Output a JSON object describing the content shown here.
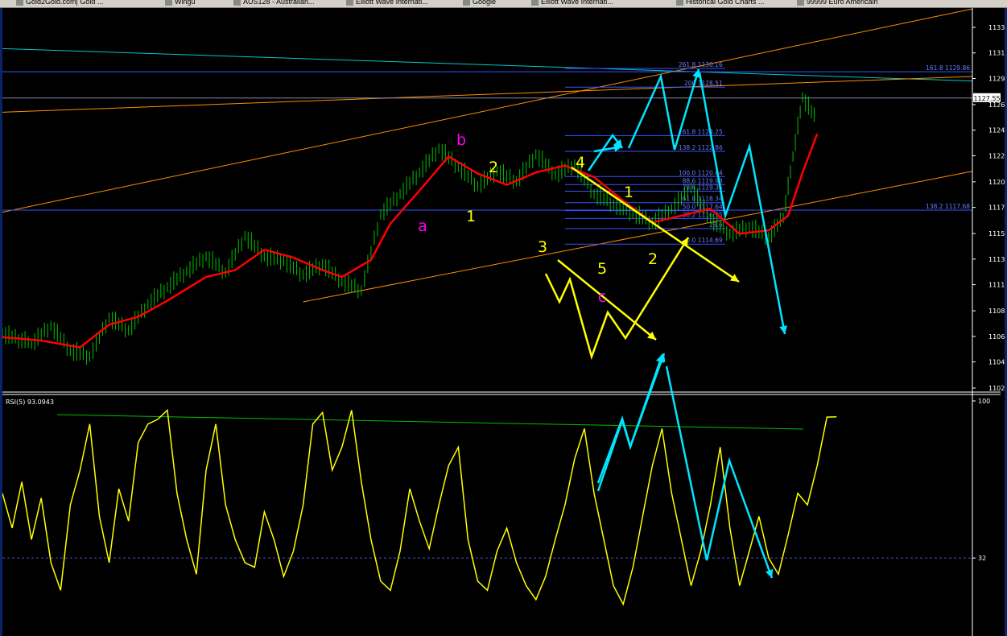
{
  "browser_tabs": [
    {
      "label": "Gold2Gold.com| Gold ...",
      "icon": "page-icon"
    },
    {
      "label": "Wingu",
      "icon": "page-icon"
    },
    {
      "label": "AUS128 - Australian...",
      "icon": "page-icon"
    },
    {
      "label": "Elliott Wave Internati...",
      "icon": "page-icon"
    },
    {
      "label": "Google",
      "icon": "google-icon"
    },
    {
      "label": "Elliott Wave Internati...",
      "icon": "page-icon"
    },
    {
      "label": "Historical Gold Charts ...",
      "icon": "page-icon"
    },
    {
      "label": "99999 Euro Americain",
      "icon": "page-icon"
    }
  ],
  "chart_data": [
    {
      "type": "line",
      "panel": "price",
      "y_ticks": [
        "1133.77",
        "1131.52",
        "1129.27",
        "1126.97",
        "1124.72",
        "1122.47",
        "1120.17",
        "1117.92",
        "1115.62",
        "1113.37",
        "1111.12",
        "1108.82",
        "1106.57",
        "1104.32",
        "1102.02"
      ],
      "ylim": [
        1102.02,
        1133.77
      ],
      "current_price_label": "1127.55",
      "series_colors": {
        "bars": "#00c000",
        "moving_average": "#ff0000"
      },
      "ma_path": [
        [
          0.0,
          1106.5
        ],
        [
          0.04,
          1106.2
        ],
        [
          0.08,
          1105.6
        ],
        [
          0.11,
          1107.6
        ],
        [
          0.14,
          1108.3
        ],
        [
          0.17,
          1109.7
        ],
        [
          0.21,
          1111.8
        ],
        [
          0.24,
          1112.4
        ],
        [
          0.27,
          1114.2
        ],
        [
          0.3,
          1113.5
        ],
        [
          0.33,
          1112.4
        ],
        [
          0.35,
          1111.8
        ],
        [
          0.38,
          1113.3
        ],
        [
          0.4,
          1116.5
        ],
        [
          0.43,
          1119.4
        ],
        [
          0.46,
          1122.4
        ],
        [
          0.49,
          1120.9
        ],
        [
          0.52,
          1119.9
        ],
        [
          0.55,
          1121.0
        ],
        [
          0.58,
          1121.6
        ],
        [
          0.61,
          1120.6
        ],
        [
          0.64,
          1118.5
        ],
        [
          0.67,
          1116.6
        ],
        [
          0.7,
          1117.2
        ],
        [
          0.73,
          1117.8
        ],
        [
          0.76,
          1115.6
        ],
        [
          0.79,
          1115.9
        ],
        [
          0.81,
          1117.2
        ],
        [
          0.825,
          1121.0
        ],
        [
          0.84,
          1124.4
        ]
      ],
      "price_path": [
        [
          0.0,
          1106.8
        ],
        [
          0.03,
          1105.9
        ],
        [
          0.05,
          1107.5
        ],
        [
          0.07,
          1105.3
        ],
        [
          0.09,
          1104.8
        ],
        [
          0.11,
          1108.2
        ],
        [
          0.13,
          1107.1
        ],
        [
          0.15,
          1109.4
        ],
        [
          0.17,
          1110.9
        ],
        [
          0.19,
          1112.3
        ],
        [
          0.21,
          1113.6
        ],
        [
          0.23,
          1112.2
        ],
        [
          0.25,
          1115.4
        ],
        [
          0.27,
          1113.6
        ],
        [
          0.29,
          1113.2
        ],
        [
          0.31,
          1112.0
        ],
        [
          0.33,
          1112.9
        ],
        [
          0.35,
          1111.4
        ],
        [
          0.37,
          1110.6
        ],
        [
          0.39,
          1117.3
        ],
        [
          0.41,
          1119.1
        ],
        [
          0.43,
          1121.0
        ],
        [
          0.45,
          1123.1
        ],
        [
          0.47,
          1121.5
        ],
        [
          0.49,
          1119.8
        ],
        [
          0.51,
          1121.1
        ],
        [
          0.53,
          1120.2
        ],
        [
          0.55,
          1122.6
        ],
        [
          0.57,
          1120.8
        ],
        [
          0.59,
          1121.7
        ],
        [
          0.61,
          1119.1
        ],
        [
          0.63,
          1118.2
        ],
        [
          0.65,
          1117.4
        ],
        [
          0.67,
          1116.6
        ],
        [
          0.69,
          1117.8
        ],
        [
          0.71,
          1119.6
        ],
        [
          0.73,
          1116.9
        ],
        [
          0.75,
          1115.6
        ],
        [
          0.77,
          1116.2
        ],
        [
          0.79,
          1115.3
        ],
        [
          0.805,
          1117.0
        ],
        [
          0.815,
          1122.4
        ],
        [
          0.825,
          1127.6
        ],
        [
          0.84,
          1125.5
        ]
      ],
      "price_bars_ext": [
        [
          0.0,
          1106.8
        ],
        [
          0.05,
          1107.5
        ],
        [
          0.08,
          1104.3
        ],
        [
          0.12,
          1108.0
        ],
        [
          0.18,
          1111.0
        ],
        [
          0.22,
          1115.6
        ],
        [
          0.3,
          1111.4
        ],
        [
          0.36,
          1110.0
        ],
        [
          0.43,
          1121.8
        ],
        [
          0.46,
          1122.7
        ],
        [
          0.56,
          1122.4
        ],
        [
          0.68,
          1116.2
        ],
        [
          0.74,
          1115.3
        ],
        [
          0.82,
          1127.8
        ]
      ],
      "fib_levels": [
        {
          "label": "261.8 1130.16",
          "price": 1130.16
        },
        {
          "label": "161.8 1129.86",
          "price": 1129.86
        },
        {
          "label": "200 1128.51",
          "price": 1128.51
        },
        {
          "label": "161.8 1124.25",
          "price": 1124.25
        },
        {
          "label": "138.2 1122.86",
          "price": 1122.86
        },
        {
          "label": "100.0 1120.64",
          "price": 1120.64
        },
        {
          "label": "88.6 1119.93",
          "price": 1119.93
        },
        {
          "label": "78.6 1119.35",
          "price": 1119.35
        },
        {
          "label": "61.8 1118.34",
          "price": 1118.34
        },
        {
          "label": "50.0 1117.64",
          "price": 1117.64
        },
        {
          "label": "138.2 1117.68",
          "price": 1117.68
        },
        {
          "label": "38.2 1116.95",
          "price": 1116.95
        },
        {
          "label": "23.6",
          "price": 1116.06
        },
        {
          "label": "0.0 1114.69",
          "price": 1114.69
        }
      ],
      "wave_labels": [
        {
          "text": "b",
          "color": "#ff00ff"
        },
        {
          "text": "a",
          "color": "#ff00ff"
        },
        {
          "text": "c",
          "color": "#ff00ff"
        },
        {
          "text": "2",
          "color": "#ffff00"
        },
        {
          "text": "1",
          "color": "#ffff00"
        },
        {
          "text": "4",
          "color": "#ffff00"
        },
        {
          "text": "1",
          "color": "#ffff00"
        },
        {
          "text": "3",
          "color": "#ffff00"
        },
        {
          "text": "5",
          "color": "#ffff00"
        },
        {
          "text": "2",
          "color": "#ffff00"
        }
      ]
    },
    {
      "type": "line",
      "panel": "indicator",
      "title": "RSI(5) 93.0943",
      "y_ticks": [
        "100",
        "32"
      ],
      "ylim": [
        0,
        100
      ],
      "series_colors": {
        "rsi": "#ffff00"
      },
      "rsi_path": [
        [
          0.0,
          60
        ],
        [
          0.01,
          45
        ],
        [
          0.02,
          65
        ],
        [
          0.03,
          40
        ],
        [
          0.04,
          58
        ],
        [
          0.05,
          30
        ],
        [
          0.06,
          18
        ],
        [
          0.07,
          55
        ],
        [
          0.08,
          70
        ],
        [
          0.09,
          90
        ],
        [
          0.1,
          50
        ],
        [
          0.11,
          30
        ],
        [
          0.12,
          62
        ],
        [
          0.13,
          48
        ],
        [
          0.14,
          82
        ],
        [
          0.15,
          90
        ],
        [
          0.16,
          92
        ],
        [
          0.17,
          96
        ],
        [
          0.18,
          60
        ],
        [
          0.19,
          40
        ],
        [
          0.2,
          25
        ],
        [
          0.21,
          70
        ],
        [
          0.22,
          90
        ],
        [
          0.23,
          55
        ],
        [
          0.24,
          40
        ],
        [
          0.25,
          30
        ],
        [
          0.26,
          28
        ],
        [
          0.27,
          52
        ],
        [
          0.28,
          40
        ],
        [
          0.29,
          24
        ],
        [
          0.3,
          35
        ],
        [
          0.31,
          55
        ],
        [
          0.32,
          90
        ],
        [
          0.33,
          95
        ],
        [
          0.34,
          70
        ],
        [
          0.35,
          80
        ],
        [
          0.36,
          96
        ],
        [
          0.37,
          65
        ],
        [
          0.38,
          40
        ],
        [
          0.39,
          22
        ],
        [
          0.4,
          18
        ],
        [
          0.41,
          35
        ],
        [
          0.42,
          62
        ],
        [
          0.43,
          48
        ],
        [
          0.44,
          36
        ],
        [
          0.45,
          55
        ],
        [
          0.46,
          72
        ],
        [
          0.47,
          80
        ],
        [
          0.48,
          40
        ],
        [
          0.49,
          22
        ],
        [
          0.5,
          18
        ],
        [
          0.51,
          35
        ],
        [
          0.52,
          45
        ],
        [
          0.53,
          30
        ],
        [
          0.54,
          20
        ],
        [
          0.55,
          14
        ],
        [
          0.56,
          24
        ],
        [
          0.57,
          40
        ],
        [
          0.58,
          55
        ],
        [
          0.59,
          75
        ],
        [
          0.6,
          88
        ],
        [
          0.61,
          60
        ],
        [
          0.62,
          40
        ],
        [
          0.63,
          20
        ],
        [
          0.64,
          12
        ],
        [
          0.65,
          28
        ],
        [
          0.66,
          50
        ],
        [
          0.67,
          72
        ],
        [
          0.68,
          88
        ],
        [
          0.69,
          60
        ],
        [
          0.7,
          40
        ],
        [
          0.71,
          20
        ],
        [
          0.72,
          35
        ],
        [
          0.73,
          55
        ],
        [
          0.74,
          80
        ],
        [
          0.75,
          45
        ],
        [
          0.76,
          20
        ],
        [
          0.77,
          35
        ],
        [
          0.78,
          50
        ],
        [
          0.79,
          32
        ],
        [
          0.8,
          25
        ],
        [
          0.81,
          42
        ],
        [
          0.82,
          60
        ],
        [
          0.83,
          55
        ],
        [
          0.84,
          72
        ],
        [
          0.85,
          93
        ],
        [
          0.86,
          93.09
        ]
      ],
      "level_32": 32
    }
  ]
}
